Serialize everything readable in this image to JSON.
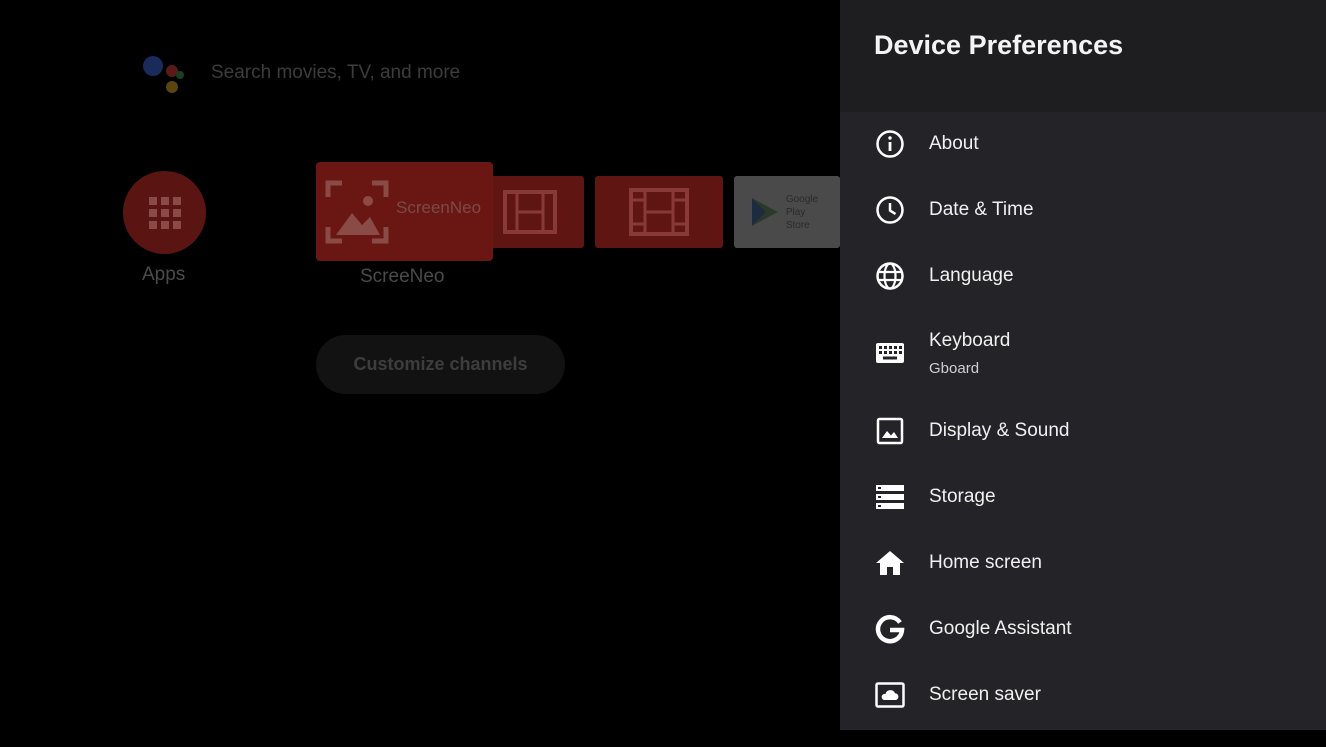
{
  "home": {
    "search_placeholder": "Search movies, TV, and more",
    "apps_label": "Apps",
    "featured_app_title": "ScreenNeo",
    "featured_app_caption": "ScreeNeo",
    "play_store_text_1": "Google Play",
    "play_store_text_2": "Store",
    "customize_label": "Customize channels"
  },
  "panel": {
    "title": "Device Preferences",
    "items": [
      {
        "label": "About",
        "icon": "info-icon"
      },
      {
        "label": "Date & Time",
        "icon": "clock-icon"
      },
      {
        "label": "Language",
        "icon": "globe-icon"
      },
      {
        "label": "Keyboard",
        "sub": "Gboard",
        "icon": "keyboard-icon"
      },
      {
        "label": "Display & Sound",
        "icon": "image-icon"
      },
      {
        "label": "Storage",
        "icon": "storage-icon"
      },
      {
        "label": "Home screen",
        "icon": "home-icon"
      },
      {
        "label": "Google Assistant",
        "icon": "google-icon"
      },
      {
        "label": "Screen saver",
        "icon": "screensaver-icon"
      }
    ]
  },
  "colors": {
    "panel_bg": "#242428",
    "panel_header_bg": "#1e1e21",
    "accent_red": "#5f1512"
  }
}
